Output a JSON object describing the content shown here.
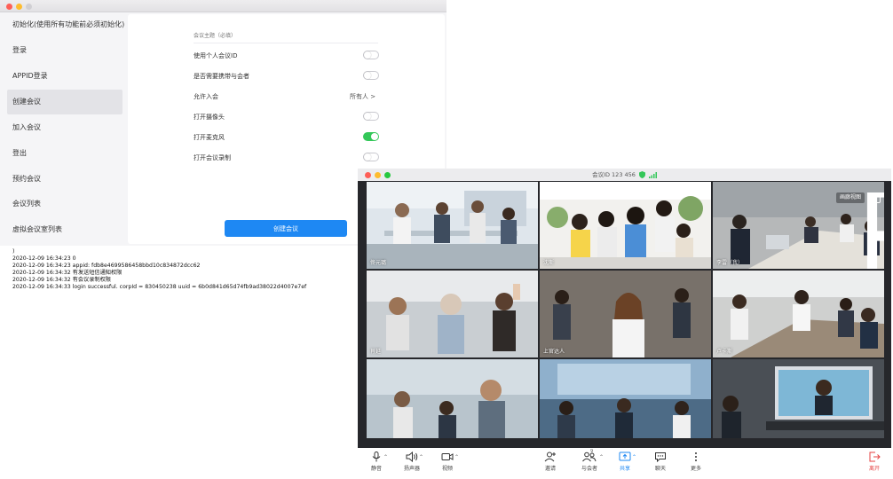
{
  "demo": {
    "sidebar": [
      {
        "label": "初始化(使用所有功能前必须初始化)",
        "active": false
      },
      {
        "label": "登录",
        "active": false
      },
      {
        "label": "APPID登录",
        "active": false
      },
      {
        "label": "创建会议",
        "active": true
      },
      {
        "label": "加入会议",
        "active": false
      },
      {
        "label": "登出",
        "active": false
      },
      {
        "label": "预约会议",
        "active": false
      },
      {
        "label": "会议列表",
        "active": false
      },
      {
        "label": "虚拟会议室列表",
        "active": false
      }
    ],
    "form": {
      "topic_placeholder": "会议主题（必填）",
      "options": [
        {
          "label": "使用个人会议ID",
          "type": "toggle",
          "on": false
        },
        {
          "label": "是否需要携带与会者",
          "type": "toggle",
          "on": false
        },
        {
          "label": "允许入会",
          "type": "select",
          "value": "所有人 >"
        },
        {
          "label": "打开摄像头",
          "type": "toggle",
          "on": false
        },
        {
          "label": "打开麦克风",
          "type": "toggle",
          "on": true
        },
        {
          "label": "打开会议录制",
          "type": "toggle",
          "on": false
        }
      ],
      "create_label": "创建会议"
    },
    "log": [
      ")",
      "2020-12-09 16:34:23 0",
      "2020-12-09 16:34:23 appid: fdb8e4699586458bbd10c834872dcc62",
      "2020-12-09 16:34:32 有发送短信通知权限",
      "2020-12-09 16:34:32 有会议录制权限",
      "2020-12-09 16:34:33 login successful. corpId = 830450238  uuid = 6b0d841d65d74fb9ad38022d4007e7ef"
    ]
  },
  "meeting": {
    "title": "会议ID 123 456",
    "gallery_label": "画廊视图",
    "tiles": [
      {
        "name": "佟元璐",
        "scene": "office"
      },
      {
        "name": "沈斯",
        "scene": "cheer"
      },
      {
        "name": "李雷（我）",
        "scene": "meeting"
      },
      {
        "name": "肖延",
        "scene": "wave"
      },
      {
        "name": "上官达人",
        "scene": "smile"
      },
      {
        "name": "卢卡斯",
        "scene": "team"
      },
      {
        "name": "",
        "scene": "laugh"
      },
      {
        "name": "",
        "scene": "present"
      },
      {
        "name": "",
        "scene": "video"
      }
    ],
    "toolbar": {
      "mute": "静音",
      "speaker": "扬声器",
      "video": "视频",
      "invite": "邀请",
      "participants": "与会者",
      "participants_count": "9",
      "share": "共享",
      "chat": "聊天",
      "more": "更多",
      "leave": "离开"
    },
    "colors": {
      "accent": "#1e88f3",
      "leave": "#e54242",
      "signal": "#34c759"
    }
  }
}
